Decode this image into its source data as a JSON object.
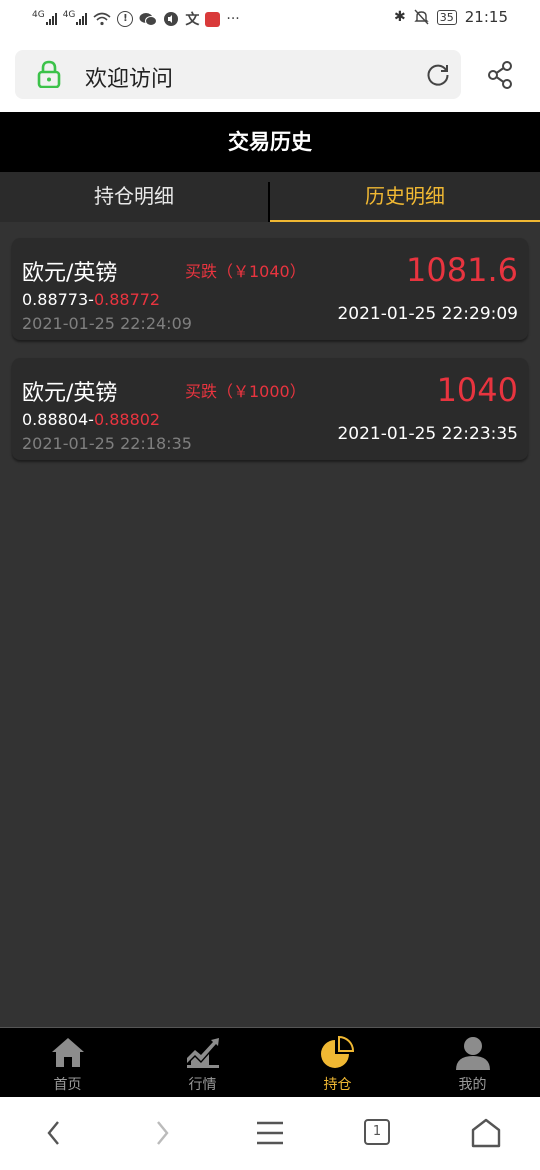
{
  "status_bar": {
    "network_1": "4G",
    "network_2": "4G",
    "overflow": "···",
    "battery": "35",
    "time": "21:15"
  },
  "browser": {
    "title": "欢迎访问"
  },
  "page": {
    "title": "交易历史"
  },
  "tabs": [
    {
      "label": "持仓明细",
      "active": false
    },
    {
      "label": "历史明细",
      "active": true
    }
  ],
  "trades": [
    {
      "pair": "欧元/英镑",
      "direction": "买跌（￥1040）",
      "profit": "1081.6",
      "open_price": "0.88773-",
      "close_price": "0.88772",
      "open_time": "2021-01-25 22:24:09",
      "close_time": "2021-01-25 22:29:09"
    },
    {
      "pair": "欧元/英镑",
      "direction": "买跌（￥1000）",
      "profit": "1040",
      "open_price": "0.88804-",
      "close_price": "0.88802",
      "open_time": "2021-01-25 22:18:35",
      "close_time": "2021-01-25 22:23:35"
    }
  ],
  "bottom_nav": [
    {
      "label": "首页",
      "icon": "home-icon",
      "active": false
    },
    {
      "label": "行情",
      "icon": "chart-icon",
      "active": false
    },
    {
      "label": "持仓",
      "icon": "pie-chart-icon",
      "active": true
    },
    {
      "label": "我的",
      "icon": "user-icon",
      "active": false
    }
  ],
  "system_nav": {
    "tab_count": "1"
  },
  "colors": {
    "accent": "#f0b833",
    "loss_red": "#e8343f",
    "background": "#333333",
    "card": "#2b2b2b"
  }
}
